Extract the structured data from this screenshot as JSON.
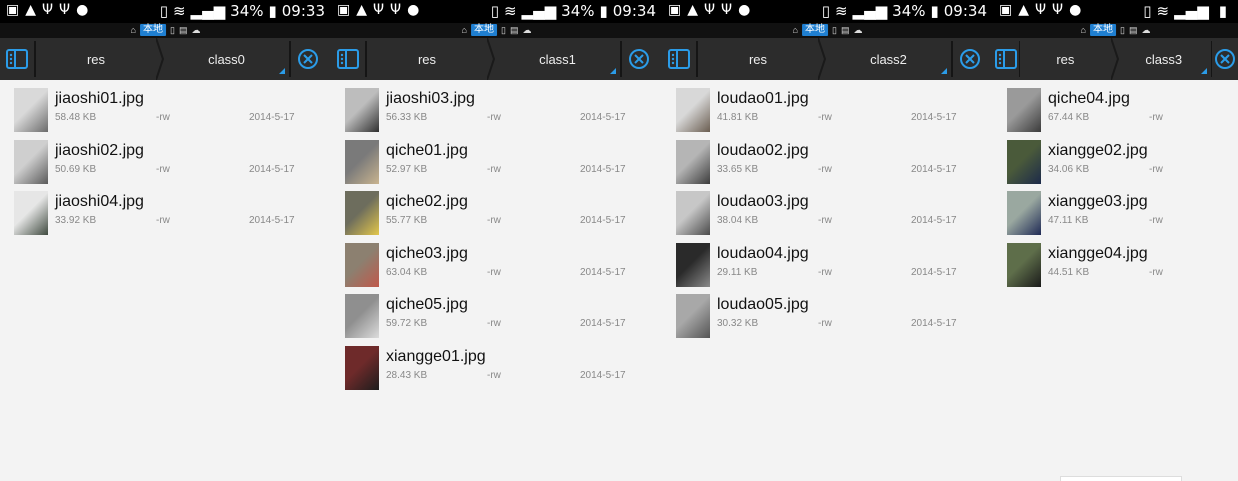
{
  "panels": [
    {
      "status": {
        "battery": "34%",
        "time": "09:33"
      },
      "substatus": {
        "local_label": "本地"
      },
      "toolbar": {
        "crumb_root": "res",
        "crumb_current": "class0"
      },
      "files": [
        {
          "name": "jiaoshi01.jpg",
          "size": "58.48 KB",
          "perm": "-rw",
          "date": "2014-5-17",
          "thumb": [
            "#d9d9d9",
            "#6b6b6b"
          ]
        },
        {
          "name": "jiaoshi02.jpg",
          "size": "50.69 KB",
          "perm": "-rw",
          "date": "2014-5-17",
          "thumb": [
            "#cfcfcf",
            "#5a5a5a"
          ]
        },
        {
          "name": "jiaoshi04.jpg",
          "size": "33.92 KB",
          "perm": "-rw",
          "date": "2014-5-17",
          "thumb": [
            "#e6e6e6",
            "#3f4a3f"
          ]
        }
      ]
    },
    {
      "status": {
        "battery": "34%",
        "time": "09:34"
      },
      "substatus": {
        "local_label": "本地"
      },
      "toolbar": {
        "crumb_root": "res",
        "crumb_current": "class1"
      },
      "files": [
        {
          "name": "jiaoshi03.jpg",
          "size": "56.33 KB",
          "perm": "-rw",
          "date": "2014-5-17",
          "thumb": [
            "#bdbdbd",
            "#2f2f2f"
          ]
        },
        {
          "name": "qiche01.jpg",
          "size": "52.97 KB",
          "perm": "-rw",
          "date": "2014-5-17",
          "thumb": [
            "#7a7a7a",
            "#c9b48f"
          ]
        },
        {
          "name": "qiche02.jpg",
          "size": "55.77 KB",
          "perm": "-rw",
          "date": "2014-5-17",
          "thumb": [
            "#6d6d5d",
            "#e2c64a"
          ]
        },
        {
          "name": "qiche03.jpg",
          "size": "63.04 KB",
          "perm": "-rw",
          "date": "2014-5-17",
          "thumb": [
            "#8c8070",
            "#c0584a"
          ]
        },
        {
          "name": "qiche05.jpg",
          "size": "59.72 KB",
          "perm": "-rw",
          "date": "2014-5-17",
          "thumb": [
            "#8f8f8f",
            "#dcdcdc"
          ]
        },
        {
          "name": "xiangge01.jpg",
          "size": "28.43 KB",
          "perm": "-rw",
          "date": "2014-5-17",
          "thumb": [
            "#6e2a2a",
            "#1d1d1d"
          ]
        }
      ]
    },
    {
      "status": {
        "battery": "34%",
        "time": "09:34"
      },
      "substatus": {
        "local_label": "本地"
      },
      "toolbar": {
        "crumb_root": "res",
        "crumb_current": "class2"
      },
      "files": [
        {
          "name": "loudao01.jpg",
          "size": "41.81 KB",
          "perm": "-rw",
          "date": "2014-5-17",
          "thumb": [
            "#d8d8d8",
            "#6a5d50"
          ]
        },
        {
          "name": "loudao02.jpg",
          "size": "33.65 KB",
          "perm": "-rw",
          "date": "2014-5-17",
          "thumb": [
            "#b5b5b5",
            "#3c3c3c"
          ]
        },
        {
          "name": "loudao03.jpg",
          "size": "38.04 KB",
          "perm": "-rw",
          "date": "2014-5-17",
          "thumb": [
            "#c7c7c7",
            "#4a4a4a"
          ]
        },
        {
          "name": "loudao04.jpg",
          "size": "29.11 KB",
          "perm": "-rw",
          "date": "2014-5-17",
          "thumb": [
            "#2a2a2a",
            "#8a8a8a"
          ]
        },
        {
          "name": "loudao05.jpg",
          "size": "30.32 KB",
          "perm": "-rw",
          "date": "2014-5-17",
          "thumb": [
            "#a8a8a8",
            "#545454"
          ]
        }
      ]
    },
    {
      "status": {
        "battery": "",
        "time": ""
      },
      "substatus": {
        "local_label": "本地"
      },
      "toolbar": {
        "crumb_root": "res",
        "crumb_current": "class3"
      },
      "files": [
        {
          "name": "qiche04.jpg",
          "size": "67.44 KB",
          "perm": "-rw",
          "date": "",
          "thumb": [
            "#9a9a9a",
            "#3b3b3b"
          ]
        },
        {
          "name": "xiangge02.jpg",
          "size": "34.06 KB",
          "perm": "-rw",
          "date": "",
          "thumb": [
            "#4a5a3a",
            "#1c2a4a"
          ]
        },
        {
          "name": "xiangge03.jpg",
          "size": "47.11 KB",
          "perm": "-rw",
          "date": "",
          "thumb": [
            "#9aa8a0",
            "#1f2a55"
          ]
        },
        {
          "name": "xiangge04.jpg",
          "size": "44.51 KB",
          "perm": "-rw",
          "date": "",
          "thumb": [
            "#5e6e4a",
            "#1a1a1a"
          ]
        }
      ]
    }
  ],
  "colors": {
    "accent": "#2b9ce8",
    "toolbar_bg": "#2c2c2c",
    "list_bg": "#f3f3f3"
  }
}
